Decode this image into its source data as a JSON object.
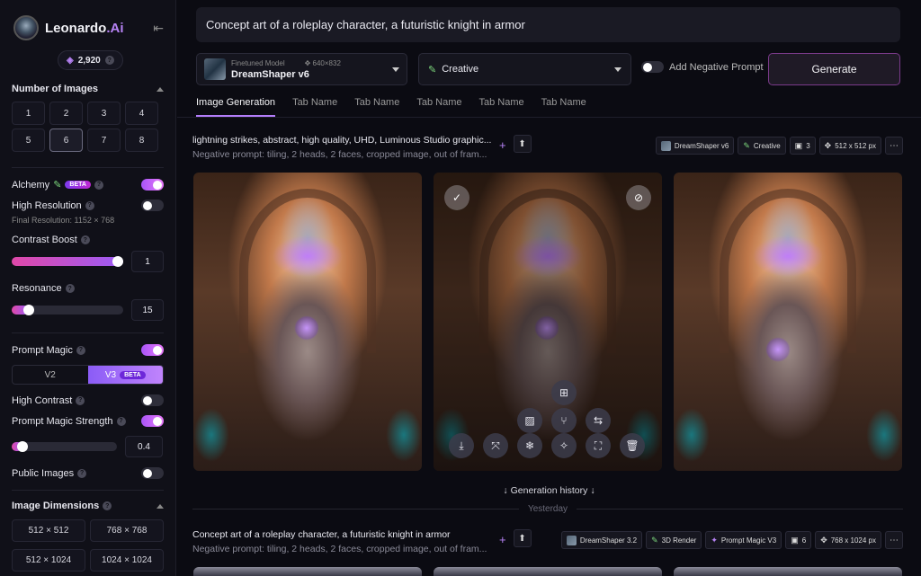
{
  "brand": {
    "name": "Leonardo",
    "suffix": ".Ai"
  },
  "tokens": {
    "count": "2,920"
  },
  "sidebar": {
    "num_images_title": "Number of Images",
    "num_options": [
      "1",
      "2",
      "3",
      "4",
      "5",
      "6",
      "7",
      "8"
    ],
    "num_selected": "6",
    "alchemy_label": "Alchemy",
    "beta_label": "BETA",
    "high_res_label": "High Resolution",
    "final_res": "Final Resolution: 1152 × 768",
    "contrast_boost_label": "Contrast Boost",
    "contrast_boost_value": "1",
    "resonance_label": "Resonance",
    "resonance_value": "15",
    "prompt_magic_label": "Prompt Magic",
    "v2_label": "V2",
    "v3_label": "V3",
    "high_contrast_label": "High Contrast",
    "pm_strength_label": "Prompt Magic Strength",
    "pm_strength_value": "0.4",
    "public_images_label": "Public Images",
    "dims_title": "Image Dimensions",
    "dims": [
      "512 × 512",
      "768 × 768",
      "512 × 1024",
      "1024 × 1024"
    ],
    "toggles": {
      "alchemy": true,
      "high_res": false,
      "prompt_magic": true,
      "high_contrast": false,
      "pm_strength": true,
      "public_images": false
    },
    "slider_levels": {
      "contrast_boost": 1.0,
      "resonance": 0.15,
      "pm_strength": 0.1
    }
  },
  "top": {
    "prompt": "Concept art of a roleplay character, a futuristic knight in armor",
    "model_small": "Finetuned Model",
    "model_res": "640×832",
    "model_name": "DreamShaper v6",
    "style": "Creative",
    "neg_label": "Add Negative Prompt",
    "generate": "Generate"
  },
  "tabs": [
    "Image Generation",
    "Tab Name",
    "Tab Name",
    "Tab Name",
    "Tab Name",
    "Tab Name"
  ],
  "gen1": {
    "prompt": "lightning strikes, abstract, high quality, UHD, Luminous Studio graphic...",
    "neg": "Negative prompt: tiling, 2 heads, 2 faces, cropped image, out of fram...",
    "chips": {
      "model": "DreamShaper v6",
      "style": "Creative",
      "count": "3",
      "size": "512 x 512 px"
    }
  },
  "history": {
    "label": "Generation history",
    "yesterday": "Yesterday"
  },
  "gen2": {
    "prompt": "Concept art of a roleplay character, a futuristic knight in armor",
    "neg": "Negative prompt: tiling, 2 heads, 2 faces, cropped image, out of fram...",
    "chips": {
      "model": "DreamShaper 3.2",
      "style": "3D Render",
      "magic": "Prompt Magic V3",
      "count": "6",
      "size": "768 x 1024 px"
    }
  },
  "colors": {
    "accent": "#b37dfa",
    "bg": "#0b0b12",
    "sidebar": "#101018"
  }
}
